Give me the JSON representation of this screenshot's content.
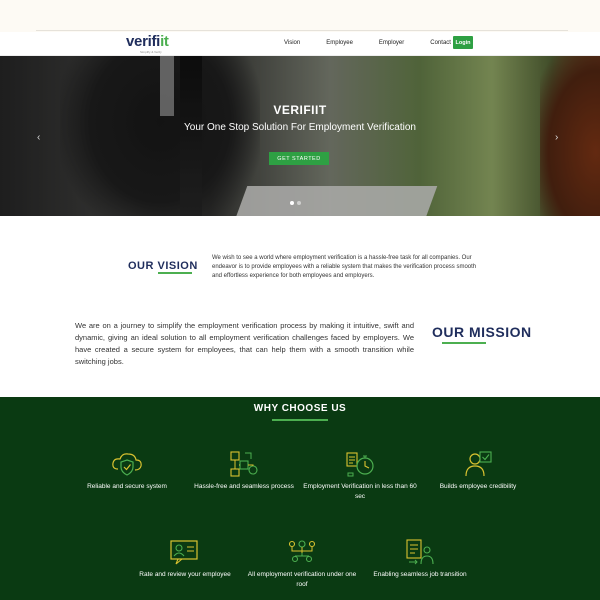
{
  "brand": {
    "logo_main": "verifi",
    "logo_accent": "it",
    "logo_tagline": "Simplify & Verify"
  },
  "nav": {
    "links": [
      "Vision",
      "Employee",
      "Employer",
      "Contact Us"
    ],
    "login_label": "Login"
  },
  "hero": {
    "title": "VERIFIIT",
    "subtitle": "Your One Stop Solution For Employment Verification",
    "cta_label": "GET STARTED",
    "prev_glyph": "‹",
    "next_glyph": "›"
  },
  "vision": {
    "heading": "OUR VISION",
    "text": "We wish to see a world where employment verification is a hassle-free task for all companies. Our endeavor is to provide employees with a reliable system that makes the verification process smooth and effortless experience for both employees and employers."
  },
  "mission": {
    "heading": "OUR MISSION",
    "text": "We are on a journey to simplify the employment verification process by making it intuitive, swift and dynamic, giving an ideal solution to all employment verification challenges faced by employers. We have created a secure system for employees, that can help them with a smooth transition while switching jobs."
  },
  "why": {
    "title": "WHY CHOOSE US",
    "features": [
      {
        "label": "Reliable and secure system",
        "icon": "shield-cloud-icon"
      },
      {
        "label": "Hassle-free and seamless process",
        "icon": "process-flow-icon"
      },
      {
        "label": "Employment Verification in less than 60 sec",
        "icon": "stopwatch-icon"
      },
      {
        "label": "Builds employee credibility",
        "icon": "verified-employee-icon"
      },
      {
        "label": "Rate and review your employee",
        "icon": "rating-card-icon"
      },
      {
        "label": "All employment verification under one roof",
        "icon": "network-people-icon"
      },
      {
        "label": "Enabling seamless job transition",
        "icon": "job-transition-icon"
      }
    ]
  },
  "colors": {
    "accent": "#2ea043",
    "navy": "#1f2d5c",
    "dark_green": "#0a3a12",
    "icon_yellow": "#d9c230"
  }
}
